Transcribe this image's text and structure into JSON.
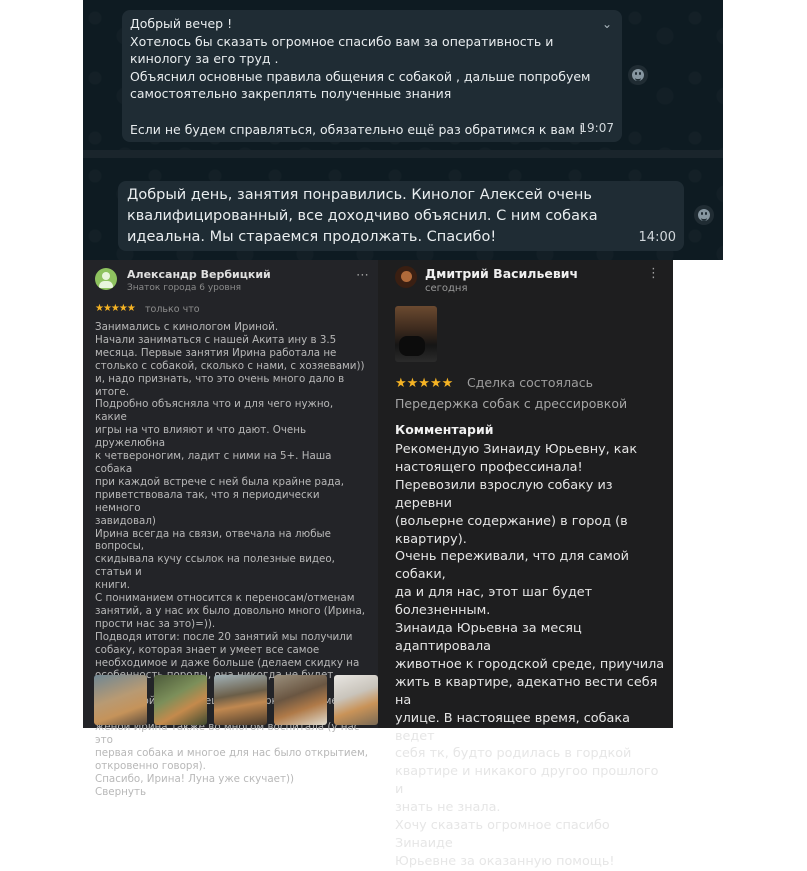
{
  "chat": {
    "message1": {
      "text": "Добрый вечер !\nХотелось бы сказать огромное спасибо вам за оперативность и кинологу за его труд .\nОбъяснил основные правила общения с собакой , дальше попробуем самостоятельно закреплять полученные знания\n\nЕсли не будем справляться, обязательно ещё раз обратимся к вам !",
      "time": "19:07"
    },
    "message2": {
      "text": "Добрый день, занятия понравились. Кинолог Алексей очень квалифицированный, все доходчиво объяснил. С ним собака идеальна. Мы стараемся продолжать. Спасибо!",
      "time": "14:00"
    }
  },
  "review1": {
    "author": "Александр Вербицкий",
    "subtitle": "Знаток города 6 уровня",
    "stars": "★★★★★",
    "rating": 5,
    "when": "только что",
    "more_icon": "⋯",
    "text": "Занимались с кинологом Ириной.\nНачали заниматься с нашей Акита ину в 3.5\nмесяца. Первые занятия Ирина работала не\nстолько с собакой, сколько с нами, с хозяевами))\nи, надо признать, что это очень много дало в итоге.\nПодробно объясняла что и для чего нужно, какие\nигры на что влияют и что дают. Очень дружелюбна\nк четвероногим, ладит с ними на 5+. Наша собака\nпри каждой встрече с ней была крайне рада,\nприветствовала так, что я периодически немного\nзавидовал)\nИрина всегда на связи, отвечала на любые вопросы,\nскидывала кучу ссылок на полезные видео, статьи и\nкниги.\nС пониманием относится к переносам/отменам\nзанятий, а у нас их было довольно много (Ирина,\nпрости нас за это)=)).\nПодводя итоги: после 20 занятий мы получили\nсобаку, которая знает и умеет все самое\nнеобходимое и даже больше (делаем скидку на\nособенность породы, она никогда не будет такой\nпослушной, как немецкая овчарка, например). Нас с\nженой Ирина также во многом воспитала (у нас это\nпервая собака и многое для нас было открытием,\nоткровенно говоря).\nСпасибо, Ирина! Луна уже скучает))\nСвернуть"
  },
  "review2": {
    "author": "Дмитрий Васильевич",
    "subtitle": "сегодня",
    "more_icon": "⋮",
    "stars": "★★★★★",
    "rating": 5,
    "deal": "Сделка состоялась",
    "category": "Передержка собак с дрессировкой",
    "comment_header": "Комментарий",
    "text": "Рекомендую Зинаиду Юрьевну, как\nнастоящего профессинала!\nПеревозили взрослую собаку из деревни\n(вольерне содержание) в город (в\nквартиру).\nОчень переживали, что для самой собаки,\nда и для нас, этот шаг будет болезненным.\nЗинаида Юрьевна за месяц адаптировала\nживотное к городской среде, приучила\nжить в квартире, адекатно вести себя на\nулице. В настоящее время, собака ведет\nсебя тк, будто родилась в гордкой\nквартире и никакого другоо прошлого и\nзнать не знала.\nХочу сказать огромное спасибо Зинаиде\nЮрьевне за оказанную помощь!"
  },
  "icons": {
    "chevron": "chevron-down-icon",
    "emoji": "emoji-icon",
    "avatar": "avatar",
    "more": "more-icon"
  },
  "colors": {
    "chat_bg": "#0e1b22",
    "bubble_bg": "#1f2c34",
    "review1_bg": "#232428",
    "review2_bg": "#1e1e1f",
    "star": "#f5b324"
  }
}
